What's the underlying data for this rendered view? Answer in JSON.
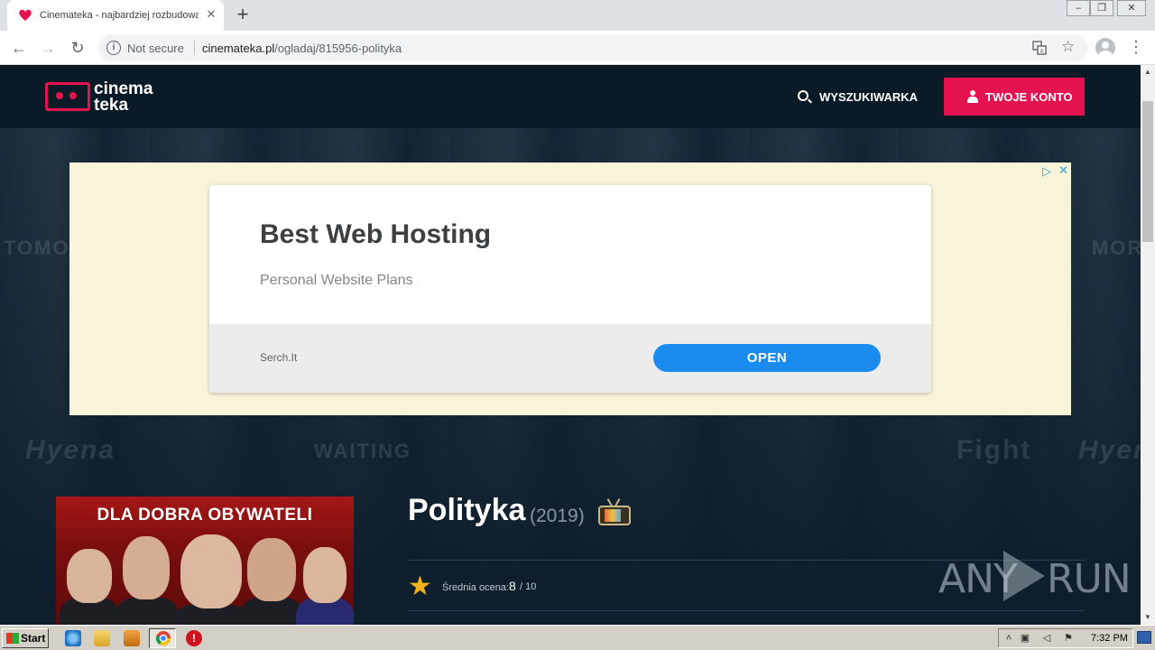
{
  "browser": {
    "tab_title": "Cinemateka - najbardziej rozbudowana",
    "new_tab_icon": "plus-icon",
    "security_label": "Not secure",
    "url_host": "cinemateka.pl",
    "url_path": "/ogladaj/815956-polityka"
  },
  "site": {
    "logo_line1": "cinema",
    "logo_line2": "teka",
    "search_label": "WYSZUKIWARKA",
    "account_label": "TWOJE KONTO",
    "accent_color": "#e4134f"
  },
  "ad": {
    "headline": "Best Web Hosting",
    "subline": "Personal Website Plans",
    "brand": "Serch.It",
    "cta": "OPEN"
  },
  "film": {
    "poster_text": "DLA DOBRA OBYWATELI",
    "title": "Polityka",
    "year": "(2019)",
    "rating_label": "Średnia ocena:",
    "rating_value": "8",
    "rating_max": "/ 10"
  },
  "watermark": {
    "left": "ANY",
    "right": "RUN"
  },
  "taskbar": {
    "start_label": "Start",
    "clock": "7:32 PM"
  }
}
